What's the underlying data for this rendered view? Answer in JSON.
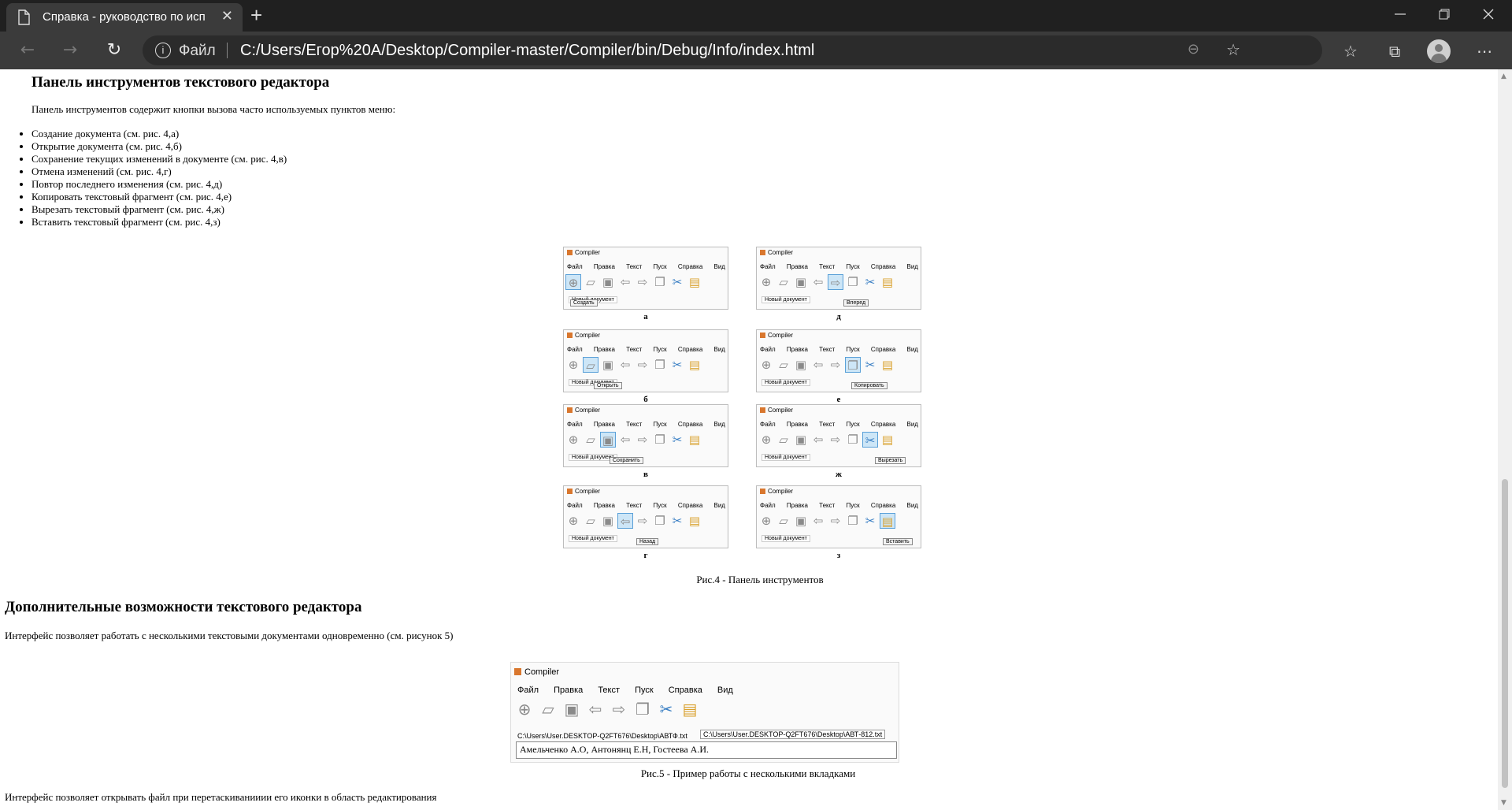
{
  "browser": {
    "tab_title": "Справка - руководство по исп",
    "tab_close": "✕",
    "new_tab": "+",
    "address_protocol": "Файл",
    "address_url": "C:/Users/Егор%20A/Desktop/Compiler-master/Compiler/bin/Debug/Info/index.html"
  },
  "page": {
    "section1_title": "Панель инструментов текстового редактора",
    "section1_intro": "Панель инструментов содержит кнопки вызова часто используемых пунктов меню:",
    "features": [
      "Создание документа (см. рис. 4,а)",
      "Открытие документа (см. рис. 4,б)",
      "Сохранение текущих изменений в документе (см. рис. 4,в)",
      "Отмена изменений (см. рис. 4,г)",
      "Повтор последнего изменения (см. рис. 4,д)",
      "Копировать текстовый фрагмент (см. рис. 4,е)",
      "Вырезать текстовый фрагмент (см. рис. 4,ж)",
      "Вставить текстовый фрагмент (см. рис. 4,з)"
    ],
    "fig4_caption": "Рис.4 - Панель инструментов",
    "section2_title": "Дополнительные возможности текстового редактора",
    "section2_text": "Интерфейс позволяет работать с несколькими текстовыми документами одновременно (см. рисунок 5)",
    "fig5_caption": "Рис.5 - Пример работы с несколькими вкладками",
    "section2_text2": "Интерфейс позволяет открывать файл при перетаскиванииии его иконки в область редактирования"
  },
  "app_screens": {
    "window_title": "Compiler",
    "menu": "Файл Правка Текст Пуск Справка Вид",
    "doc_label": "Новый документ",
    "panels": [
      {
        "letter": "а",
        "tooltip": "Создать"
      },
      {
        "letter": "д",
        "tooltip": "Вперед"
      },
      {
        "letter": "б",
        "tooltip": "Открыть"
      },
      {
        "letter": "е",
        "tooltip": "Копировать"
      },
      {
        "letter": "в",
        "tooltip": "Сохранить"
      },
      {
        "letter": "ж",
        "tooltip": "Вырезать"
      },
      {
        "letter": "г",
        "tooltip": "Назад"
      },
      {
        "letter": "з",
        "tooltip": "Вставить"
      }
    ]
  },
  "fig5": {
    "window_title": "Compiler",
    "menu": "Файл Правка Текст Пуск Справка Вид",
    "tab1": "C:\\Users\\User.DESKTOP-Q2FT676\\Desktop\\АВТФ.txt",
    "tab2": "C:\\Users\\User.DESKTOP-Q2FT676\\Desktop\\АВТ-812.txt",
    "editor_text": "Амельченко А.О, Антонянц Е.Н, Гостеева А.И."
  },
  "icons": {
    "page": "page-icon",
    "back": "arrow-left-icon",
    "forward": "arrow-right-icon",
    "refresh": "refresh-icon",
    "info": "info-icon",
    "zoom": "zoom-out-icon",
    "favorite": "star-add-icon",
    "favorites": "favorites-icon",
    "collections": "collections-icon",
    "profile": "profile-icon",
    "more": "more-icon"
  }
}
